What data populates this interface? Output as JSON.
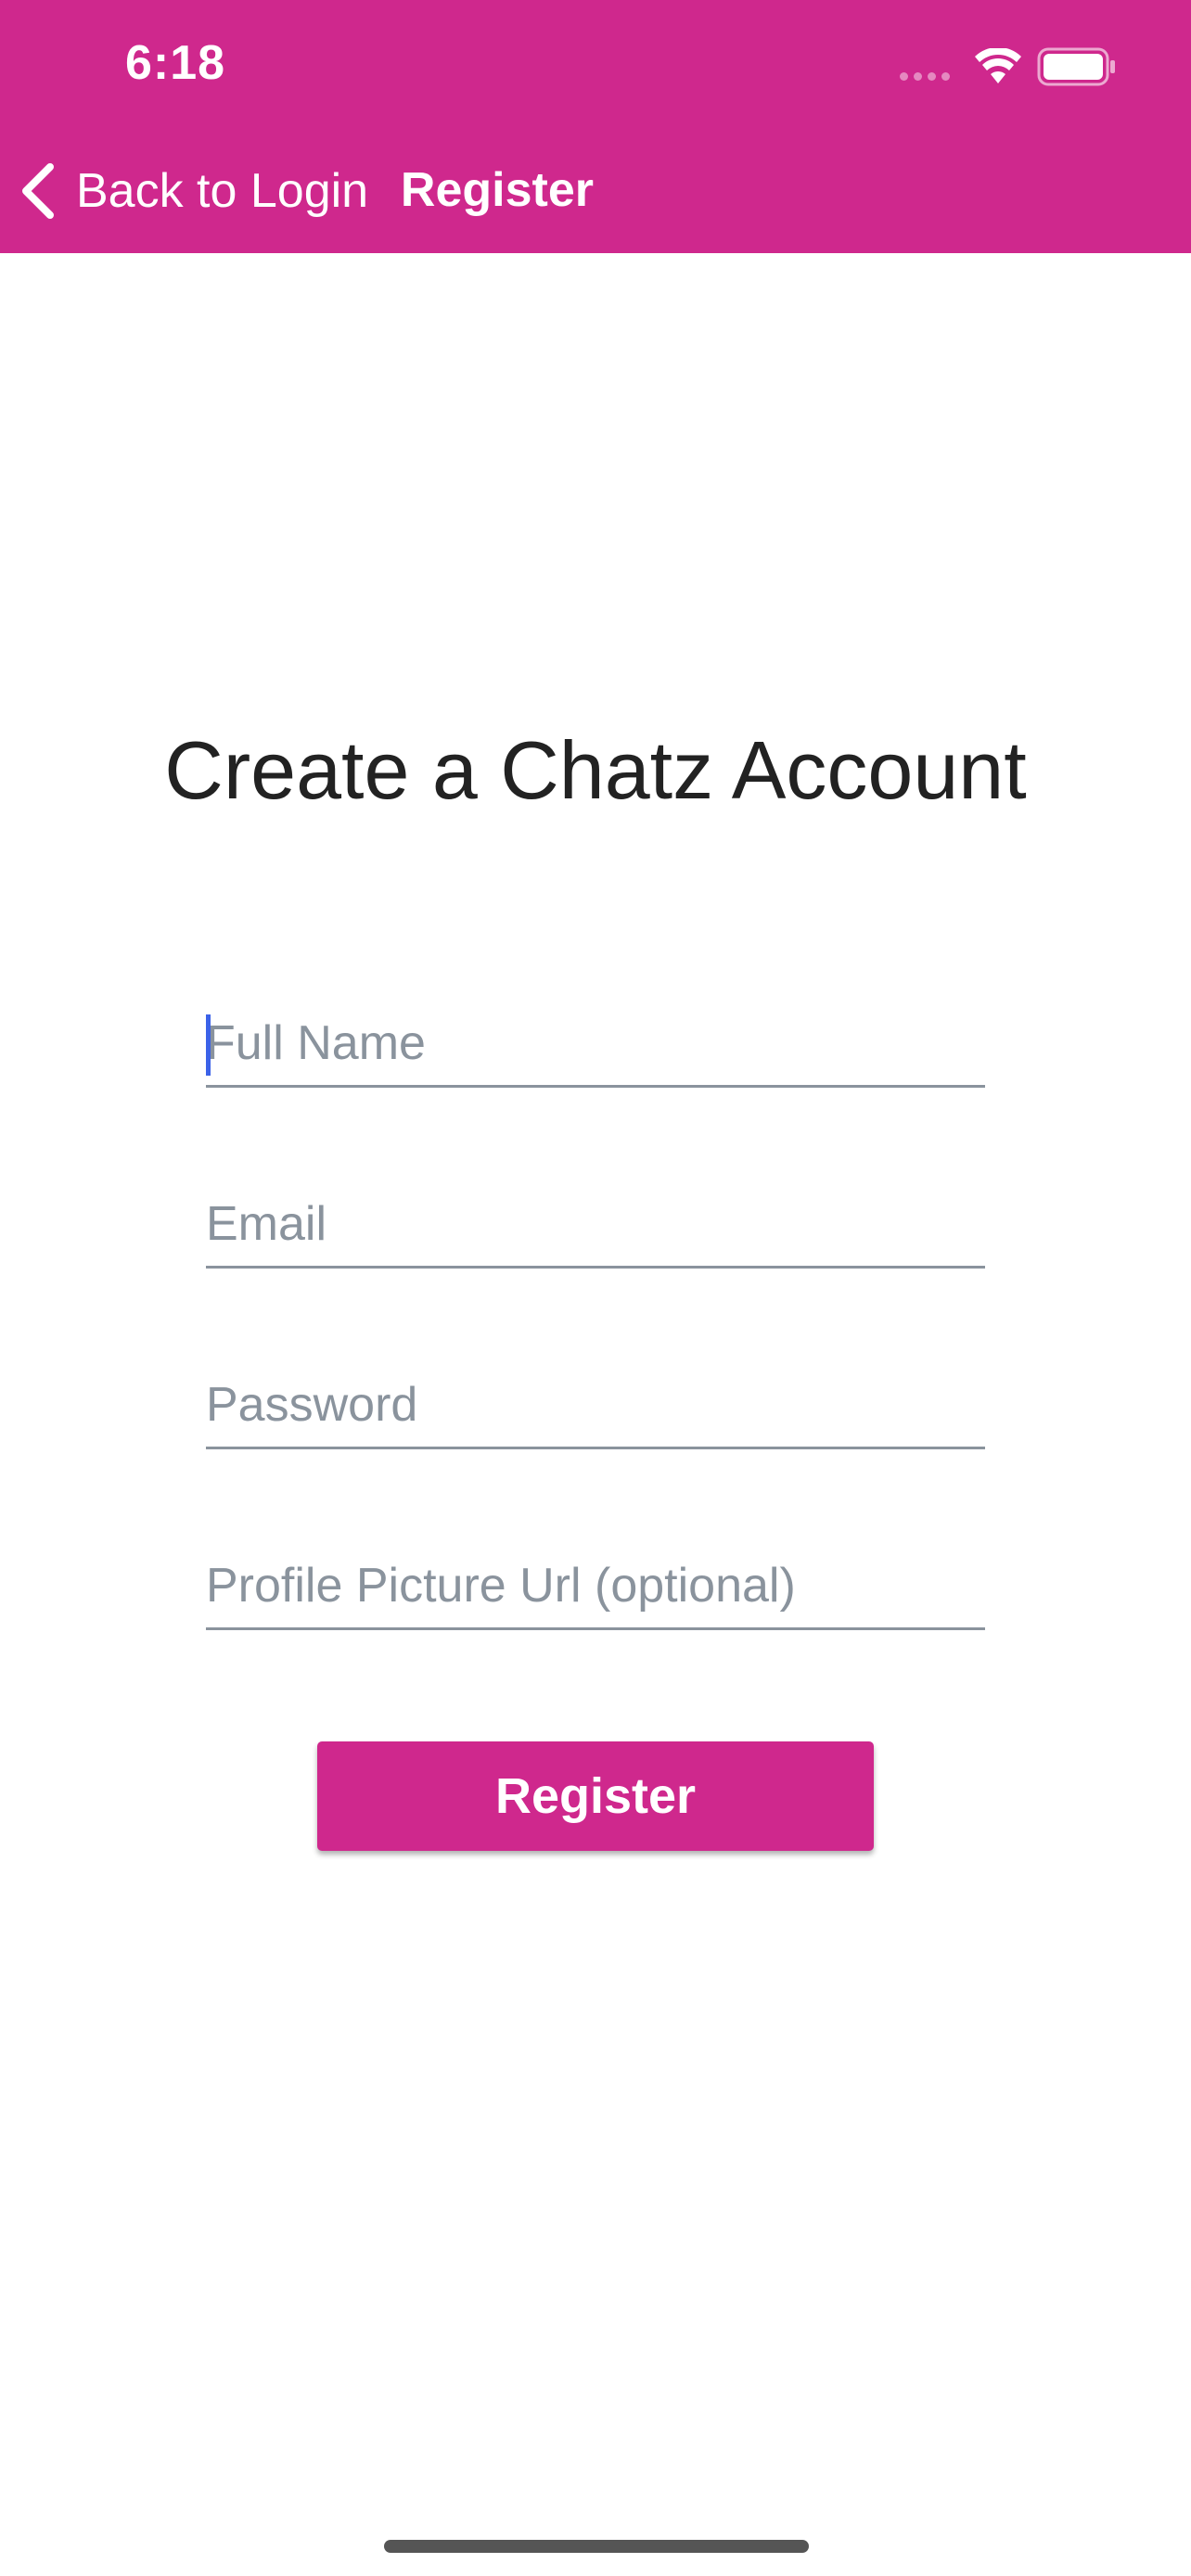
{
  "status_bar": {
    "time": "6:18"
  },
  "nav_bar": {
    "back_label": "Back to Login",
    "title": "Register",
    "background": "#CF288D"
  },
  "form": {
    "heading": "Create a Chatz Account",
    "fields": [
      {
        "placeholder": "Full Name",
        "value": ""
      },
      {
        "placeholder": "Email",
        "value": ""
      },
      {
        "placeholder": "Password",
        "value": ""
      },
      {
        "placeholder": "Profile Picture Url (optional)",
        "value": ""
      }
    ],
    "submit_label": "Register"
  },
  "icons": {
    "back": "chevron-left-icon",
    "wifi": "wifi-icon",
    "battery": "battery-icon",
    "signal": "cellular-signal-icon"
  },
  "colors": {
    "accent": "#CF288D",
    "placeholder": "#8A939D",
    "caret": "#3B62E8"
  }
}
